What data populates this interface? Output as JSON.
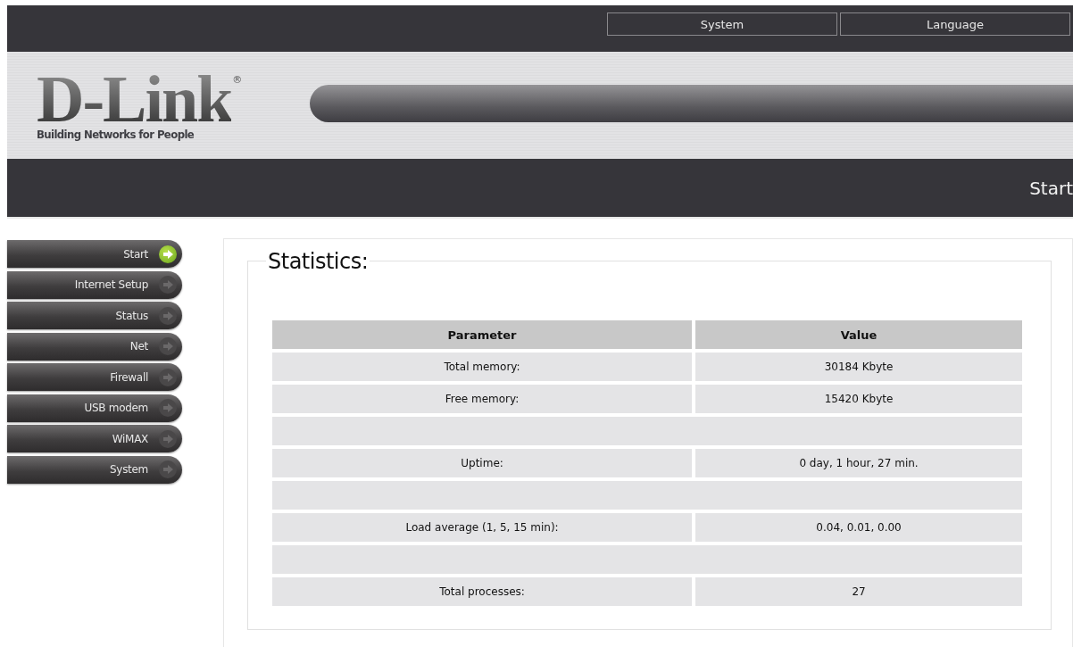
{
  "top_menu": [
    {
      "label": "System"
    },
    {
      "label": "Language"
    }
  ],
  "logo": {
    "brand": "D-Link",
    "mark": "®",
    "tagline": "Building Networks for People"
  },
  "page_title": "Start",
  "sidebar": {
    "items": [
      {
        "label": "Start",
        "selected": true
      },
      {
        "label": "Internet Setup",
        "selected": false
      },
      {
        "label": "Status",
        "selected": false
      },
      {
        "label": "Net",
        "selected": false
      },
      {
        "label": "Firewall",
        "selected": false
      },
      {
        "label": "USB modem",
        "selected": false
      },
      {
        "label": "WiMAX",
        "selected": false
      },
      {
        "label": "System",
        "selected": false
      }
    ]
  },
  "statistics": {
    "title": "Statistics:",
    "columns": [
      "Parameter",
      "Value"
    ],
    "rows": [
      {
        "kind": "data",
        "parameter": "Total memory:",
        "value": "30184 Kbyte"
      },
      {
        "kind": "data",
        "parameter": "Free memory:",
        "value": "15420 Kbyte"
      },
      {
        "kind": "spacer"
      },
      {
        "kind": "data",
        "parameter": "Uptime:",
        "value": "0 day, 1 hour, 27 min."
      },
      {
        "kind": "spacer"
      },
      {
        "kind": "data",
        "parameter": "Load average (1, 5, 15 min):",
        "value": "0.04, 0.01, 0.00"
      },
      {
        "kind": "spacer"
      },
      {
        "kind": "data",
        "parameter": "Total processes:",
        "value": "27"
      }
    ]
  }
}
